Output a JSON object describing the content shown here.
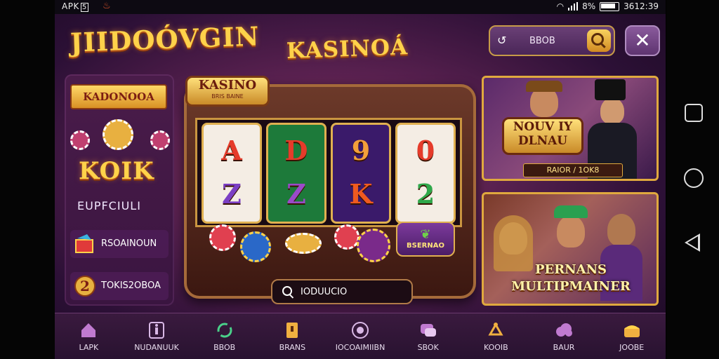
{
  "status_bar": {
    "left_text": "APK",
    "icon_label": "5",
    "battery": "8%",
    "time": "3612:39"
  },
  "header": {
    "logo_left": "JIIDOÓVGIN",
    "logo_center": "KASINOÁ"
  },
  "search": {
    "back_icon": "back-arrow-icon",
    "value": "BBOB",
    "search_icon": "search-icon"
  },
  "close": {
    "glyph": "✕"
  },
  "left_panel": {
    "badge": "KADONOOA",
    "big_label": "KOIK",
    "sub_label": "EUPFCIULI",
    "rows": [
      {
        "label": "RSOAINOUN",
        "icon": "gift-icon"
      },
      {
        "label": "TOKIS2OBOA",
        "icon": "two-coin-icon"
      }
    ]
  },
  "slot": {
    "sign_title": "KASINO",
    "sign_sub": "BRIS BAINE",
    "reels": [
      {
        "symbols": [
          "A",
          "Z"
        ],
        "bg": "#f4ede4",
        "colors": [
          "#e53b2a",
          "#7b3fc4"
        ]
      },
      {
        "symbols": [
          "D",
          "Z"
        ],
        "bg": "#1d7a3a",
        "colors": [
          "#e53b2a",
          "#9a4ac8"
        ]
      },
      {
        "symbols": [
          "9",
          "K"
        ],
        "bg": "#3a1a6a",
        "colors": [
          "#f3a03a",
          "#ef5a20"
        ]
      },
      {
        "symbols": [
          "0",
          "2"
        ],
        "bg": "#f4ede4",
        "colors": [
          "#e53b2a",
          "#2fa84a"
        ]
      }
    ],
    "bonus_label": "BSERNAO",
    "search_value": "IODUUCIO"
  },
  "cards": [
    {
      "title_line1": "NOUV IY",
      "title_line2": "DLNAU",
      "subtitle": "RAIOR / 1OK8"
    },
    {
      "title_line1": "PERNANS",
      "title_line2": "MULTIPMAINER"
    }
  ],
  "nav": [
    {
      "label": "LAPK",
      "icon": "home-icon"
    },
    {
      "label": "NUDANUUK",
      "icon": "info-icon"
    },
    {
      "label": "BBOB",
      "icon": "refresh-icon"
    },
    {
      "label": "BRANS",
      "icon": "document-icon"
    },
    {
      "label": "IOCOAIMIIBN",
      "icon": "target-icon"
    },
    {
      "label": "SBOK",
      "icon": "chat-icon"
    },
    {
      "label": "KOOIB",
      "icon": "network-icon"
    },
    {
      "label": "BAUR",
      "icon": "cloud-icon"
    },
    {
      "label": "JOOBE",
      "icon": "chest-icon"
    }
  ],
  "colors": {
    "gold": "#ffd24a",
    "purple_bg": "#2c1036",
    "border_gold": "#e0a93e"
  }
}
